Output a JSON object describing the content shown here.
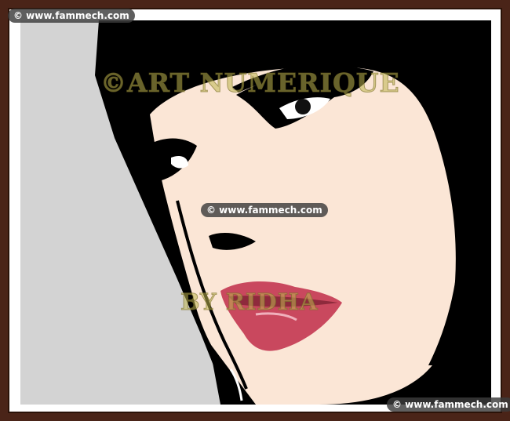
{
  "watermarks": {
    "top": "© www.fammech.com",
    "center": "© www.fammech.com",
    "bottom": "© www.fammech.com"
  },
  "artwork": {
    "title_text": "©ART NUMERIQUE",
    "byline_text": "BY RIDHA"
  },
  "colors": {
    "frame": "#4a2418",
    "background": "#d3d3d3",
    "skin": "#fbe6d6",
    "hair": "#000000",
    "lips": "#c9485e",
    "watermark_text": "#bfb450"
  }
}
